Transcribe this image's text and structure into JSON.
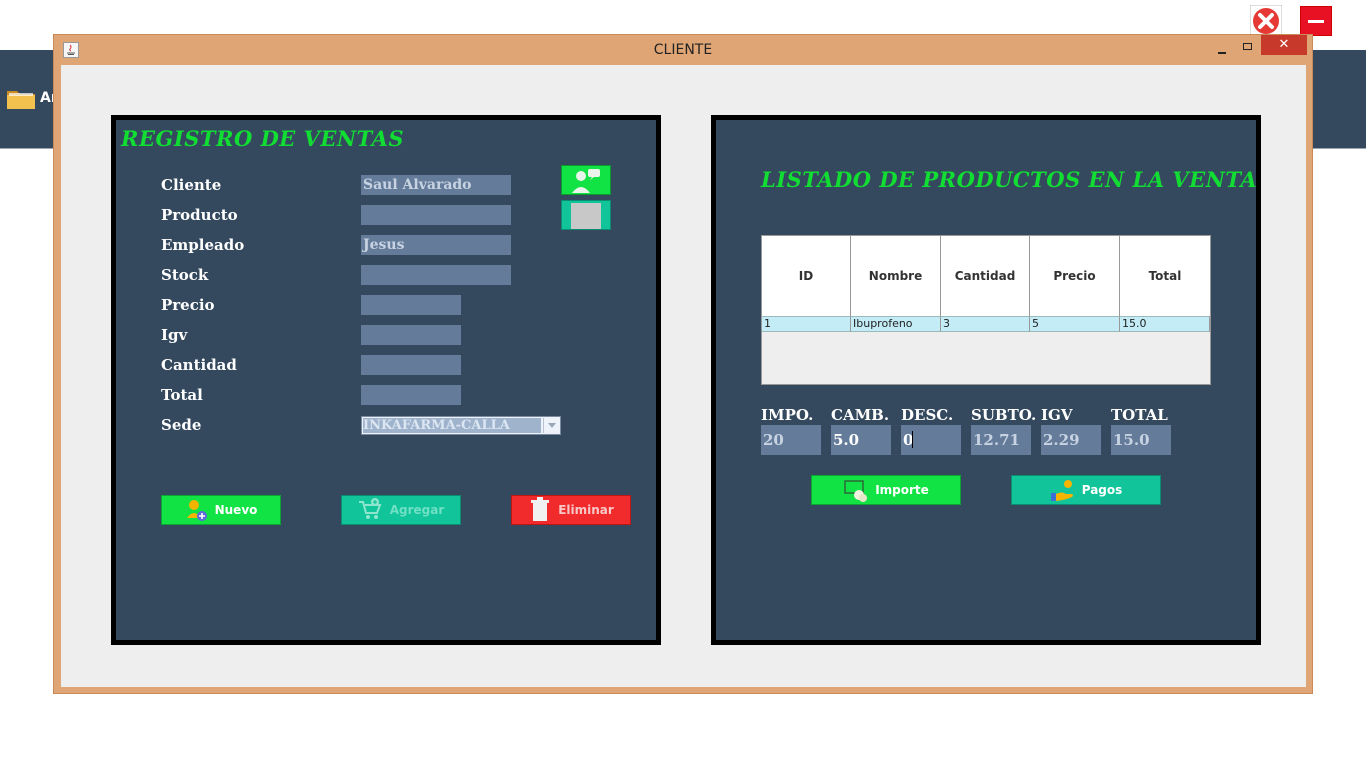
{
  "background_app": {
    "menu_text": "Ar"
  },
  "window": {
    "title": "CLIENTE",
    "close_glyph": "✕"
  },
  "registro": {
    "title": "REGISTRO DE VENTAS",
    "labels": {
      "cliente": "Cliente",
      "producto": "Producto",
      "empleado": "Empleado",
      "stock": "Stock",
      "precio": "Precio",
      "igv": "Igv",
      "cantidad": "Cantidad",
      "total": "Total",
      "sede": "Sede"
    },
    "values": {
      "cliente": "Saul Alvarado",
      "producto": "",
      "empleado": "Jesus",
      "stock": "",
      "precio": "",
      "igv": "",
      "cantidad": "",
      "total": "",
      "sede": "INKAFARMA-CALLA"
    },
    "buttons": {
      "nuevo": "Nuevo",
      "agregar": "Agregar",
      "eliminar": "Eliminar"
    }
  },
  "listado": {
    "title": "LISTADO DE PRODUCTOS EN LA VENTA",
    "columns": [
      "ID",
      "Nombre",
      "Cantidad",
      "Precio",
      "Total"
    ],
    "rows": [
      [
        "1",
        "Ibuprofeno",
        "3",
        "5",
        "15.0"
      ]
    ],
    "summary": {
      "impo_label": "IMPO.",
      "impo": "20",
      "camb_label": "CAMB.",
      "camb": "5.0",
      "desc_label": "DESC.",
      "desc": "0",
      "subto_label": "SUBTO.",
      "subto": "12.71",
      "igv_label": "IGV",
      "igv": "2.29",
      "total_label": "TOTAL",
      "total": "15.0"
    },
    "buttons": {
      "importe": "Importe",
      "pagos": "Pagos"
    }
  },
  "colors": {
    "panel": "#34495e",
    "title_green": "#11dd33",
    "btn_green": "#11e344",
    "btn_teal": "#11c49a",
    "btn_red": "#f12b2b",
    "field": "#647c9a"
  }
}
